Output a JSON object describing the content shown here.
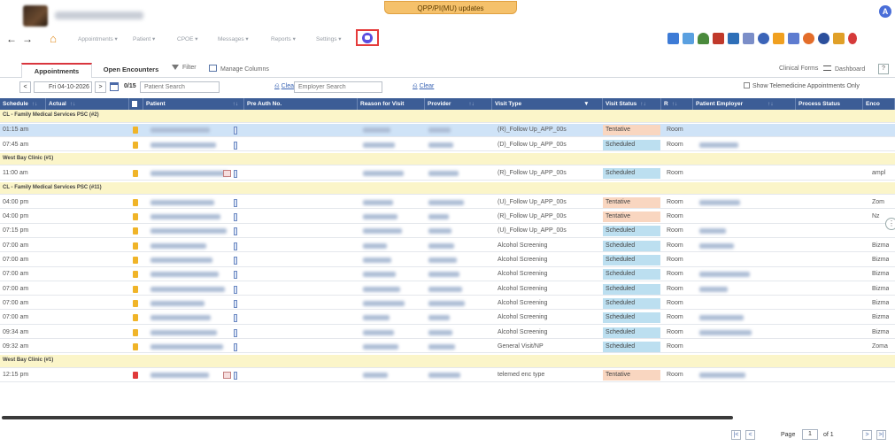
{
  "header": {
    "update_banner": "QPP/PI(MU) updates",
    "user_initial": "A"
  },
  "nav": {
    "menus": [
      "Appointments ▾",
      "Patient ▾",
      "CPOE ▾",
      "Messages ▾",
      "Reports ▾",
      "Settings ▾"
    ],
    "back": "←",
    "forward": "→",
    "home": "⌂"
  },
  "tabs": {
    "appointments": "Appointments",
    "open_encounters": "Open Encounters",
    "filter": "Filter",
    "manage_columns": "Manage Columns",
    "clinical_forms": "Clinical Forms",
    "dashboard": "Dashboard",
    "help": "?"
  },
  "filters": {
    "prev": "<",
    "date": "Fri 04-10-2026",
    "next": ">",
    "count": "0/15",
    "patient_search_placeholder": "Patient Search",
    "clear1": "Clear",
    "employer_search_placeholder": "Employer Search",
    "clear2": "Clear",
    "telemedicine_label": "Show Telemedicine Appointments Only"
  },
  "table": {
    "columns": [
      "Schedule",
      "Actual",
      "",
      "Patient",
      "Pre Auth No.",
      "Reason for Visit",
      "Provider",
      "Visit Type",
      "Visit Status",
      "R",
      "Patient Employer",
      "Process Status",
      "Enco"
    ],
    "rows": [
      {
        "group": "CL - Family Medical Services PSC (#2)"
      },
      {
        "schedule": "01:15 am",
        "visit_type": "(R)_Follow Up_APP_00s",
        "status": "Tentative",
        "room": "Room",
        "selected": true,
        "enc": ""
      },
      {
        "schedule": "07:45 am",
        "visit_type": "(D)_Follow Up_APP_00s",
        "status": "Scheduled",
        "room": "Room",
        "enc": ""
      },
      {
        "group": "West Bay Clinic (#1)"
      },
      {
        "schedule": "11:00 am",
        "visit_type": "(R)_Follow Up_APP_00s",
        "status": "Scheduled",
        "room": "Room",
        "enc": "ampl",
        "alert": true
      },
      {
        "group": "CL - Family Medical Services PSC (#11)"
      },
      {
        "schedule": "04:00 pm",
        "visit_type": "(U)_Follow Up_APP_00s",
        "status": "Tentative",
        "room": "Room",
        "enc": "Zom"
      },
      {
        "schedule": "04:00 pm",
        "visit_type": "(R)_Follow Up_APP_00s",
        "status": "Tentative",
        "room": "Room",
        "enc": "Nz"
      },
      {
        "schedule": "07:15 pm",
        "visit_type": "(U)_Follow Up_APP_00s",
        "status": "Scheduled",
        "room": "Room",
        "enc": ""
      },
      {
        "schedule": "07:00 am",
        "visit_type": "Alcohol Screening",
        "status": "Scheduled",
        "room": "Room",
        "enc": "Bizma"
      },
      {
        "schedule": "07:00 am",
        "visit_type": "Alcohol Screening",
        "status": "Scheduled",
        "room": "Room",
        "enc": "Bizma"
      },
      {
        "schedule": "07:00 am",
        "visit_type": "Alcohol Screening",
        "status": "Scheduled",
        "room": "Room",
        "enc": "Bizma"
      },
      {
        "schedule": "07:00 am",
        "visit_type": "Alcohol Screening",
        "status": "Scheduled",
        "room": "Room",
        "enc": "Bizma"
      },
      {
        "schedule": "07:00 am",
        "visit_type": "Alcohol Screening",
        "status": "Scheduled",
        "room": "Room",
        "enc": "Bizma"
      },
      {
        "schedule": "07:00 am",
        "visit_type": "Alcohol Screening",
        "status": "Scheduled",
        "room": "Room",
        "enc": "Bizma"
      },
      {
        "schedule": "09:34 am",
        "visit_type": "Alcohol Screening",
        "status": "Scheduled",
        "room": "Room",
        "enc": "Bizma"
      },
      {
        "schedule": "09:32 am",
        "visit_type": "General Visit/NP",
        "status": "Scheduled",
        "room": "Room",
        "enc": "Zoma"
      },
      {
        "group": "West Bay Clinic (#1)"
      },
      {
        "schedule": "12:15 pm",
        "visit_type": "telemed enc type",
        "status": "Tentative",
        "room": "Room",
        "enc": "",
        "alert": true,
        "red": true
      }
    ]
  },
  "pager": {
    "page_label": "Page",
    "page_value": "1",
    "of_label": "of 1"
  },
  "colors": {
    "header_blue": "#3c5d96",
    "tentative": "#f9d6c0",
    "scheduled": "#bcdff0",
    "group_row": "#fbf5c9",
    "accent_red": "#d9363e"
  }
}
